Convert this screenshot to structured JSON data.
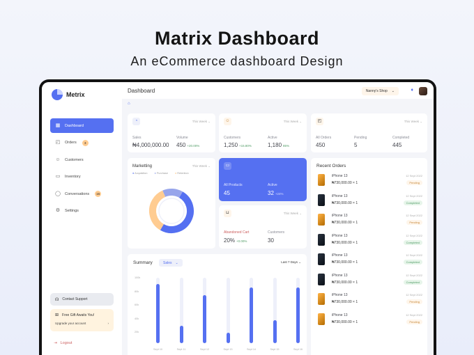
{
  "hero": {
    "title": "Matrix Dashboard",
    "subtitle": "An eCommerce dashboard Design"
  },
  "brand": {
    "name": "Metrix",
    "accent": "#5570f1"
  },
  "sidebar": {
    "items": [
      {
        "label": "Dashboard",
        "icon": "grid-icon",
        "active": true
      },
      {
        "label": "Orders",
        "icon": "bag-icon",
        "badge": "3"
      },
      {
        "label": "Customers",
        "icon": "users-icon"
      },
      {
        "label": "Inventory",
        "icon": "folder-icon"
      },
      {
        "label": "Conversations",
        "icon": "chat-icon",
        "badge": "16"
      },
      {
        "label": "Settings",
        "icon": "gear-icon"
      }
    ],
    "support": "Contact Support",
    "gift": {
      "title": "Free Gift Awaits You!",
      "cta": "Upgrade your account"
    },
    "logout": "Logout"
  },
  "header": {
    "title": "Dashboard",
    "shop": "Nanny's Shop"
  },
  "period_label": "This Week",
  "cards": {
    "sales": {
      "label1": "Sales",
      "value1": "₦4,000,000.00",
      "label2": "Volume",
      "value2": "450",
      "delta2": "+20.00%"
    },
    "customers": {
      "label1": "Customers",
      "value1": "1,250",
      "delta1": "+15.80%",
      "label2": "Active",
      "value2": "1,180",
      "delta2": "85%"
    },
    "orders": {
      "label1": "All Orders",
      "value1": "450",
      "label2": "Pending",
      "value2": "5",
      "label3": "Completed",
      "value3": "445"
    },
    "marketing": {
      "title": "Marketting",
      "legend": [
        "Acquisition",
        "Purchase",
        "Retention"
      ]
    },
    "products": {
      "label1": "All Products",
      "value1": "45",
      "label2": "Active",
      "value2": "32",
      "delta2": "+24%"
    },
    "cart": {
      "label1": "Abandoned Cart",
      "value1": "20%",
      "delta1": "+0.00%",
      "label2": "Customers",
      "value2": "30"
    }
  },
  "recent_orders": {
    "title": "Recent Orders",
    "items": [
      {
        "name": "iPhone 13",
        "price": "₦730,000.00 × 1",
        "date": "12 Sept 2022",
        "status": "Pending",
        "thumb": "gold"
      },
      {
        "name": "iPhone 13",
        "price": "₦730,000.00 × 1",
        "date": "12 Sept 2022",
        "status": "Completed",
        "thumb": "dark"
      },
      {
        "name": "iPhone 13",
        "price": "₦730,000.00 × 1",
        "date": "12 Sept 2022",
        "status": "Pending",
        "thumb": "gold"
      },
      {
        "name": "iPhone 13",
        "price": "₦730,000.00 × 1",
        "date": "12 Sept 2022",
        "status": "Completed",
        "thumb": "dark"
      },
      {
        "name": "iPhone 13",
        "price": "₦730,000.00 × 1",
        "date": "12 Sept 2022",
        "status": "Completed",
        "thumb": "dark"
      },
      {
        "name": "iPhone 13",
        "price": "₦730,000.00 × 1",
        "date": "12 Sept 2022",
        "status": "Completed",
        "thumb": "dark"
      },
      {
        "name": "iPhone 13",
        "price": "₦730,000.00 × 1",
        "date": "12 Sept 2022",
        "status": "Pending",
        "thumb": "gold"
      },
      {
        "name": "iPhone 13",
        "price": "₦730,000.00 × 1",
        "date": "12 Sept 2022",
        "status": "Pending",
        "thumb": "gold"
      }
    ]
  },
  "summary": {
    "title": "Summary",
    "filter": "Sales",
    "range": "Last 7 Days"
  },
  "chart_data": [
    {
      "type": "pie",
      "categories": [
        "Acquisition",
        "Purchase",
        "Retention"
      ],
      "values": [
        50,
        35,
        15
      ],
      "colors": [
        "#5570f1",
        "#ffcc91",
        "#97a5eb"
      ]
    },
    {
      "type": "bar",
      "categories": [
        "Sept 10",
        "Sept 11",
        "Sept 12",
        "Sept 13",
        "Sept 14",
        "Sept 15",
        "Sept 16"
      ],
      "values": [
        90,
        27,
        73,
        16,
        85,
        35,
        85
      ],
      "yticks": [
        "100k",
        "80k",
        "60k",
        "40k",
        "20k"
      ],
      "ylim": [
        0,
        100
      ]
    }
  ]
}
